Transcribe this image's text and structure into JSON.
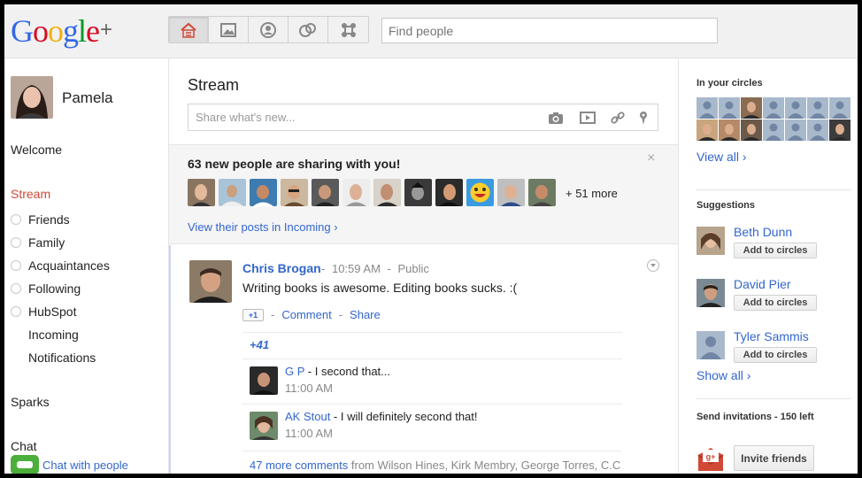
{
  "brand": {
    "letters": [
      {
        "ch": "G",
        "color": "#3369e8"
      },
      {
        "ch": "o",
        "color": "#d50f25"
      },
      {
        "ch": "o",
        "color": "#eeb211"
      },
      {
        "ch": "g",
        "color": "#3369e8"
      },
      {
        "ch": "l",
        "color": "#009925"
      },
      {
        "ch": "e",
        "color": "#d50f25"
      }
    ],
    "plus": "+"
  },
  "nav": {
    "buttons": [
      {
        "name": "home",
        "icon": "home-stream-icon",
        "active": true
      },
      {
        "name": "photos",
        "icon": "photos-icon",
        "active": false
      },
      {
        "name": "profile",
        "icon": "profile-icon",
        "active": false
      },
      {
        "name": "circles",
        "icon": "circles-icon",
        "active": false
      },
      {
        "name": "games",
        "icon": "games-icon",
        "active": false
      }
    ],
    "search_placeholder": "Find people"
  },
  "left": {
    "user_name": "Pamela",
    "welcome": "Welcome",
    "stream": "Stream",
    "circles": [
      "Friends",
      "Family",
      "Acquaintances",
      "Following",
      "HubSpot"
    ],
    "incoming": "Incoming",
    "notifications": "Notifications",
    "sparks": "Sparks",
    "chat": "Chat",
    "chat_link": "Chat with people"
  },
  "main": {
    "title": "Stream",
    "share_placeholder": "Share what's new...",
    "new_people": {
      "title": "63 new people are sharing with you!",
      "close": "×",
      "more": "+ 51 more",
      "link": "View their posts in Incoming ›"
    },
    "post": {
      "author": "Chris Brogan",
      "time": "10:59 AM",
      "visibility": "Public",
      "text": "Writing books is awesome. Editing books sucks. :(",
      "plusone_label": "+1",
      "comment_label": "Comment",
      "share_label": "Share",
      "separator": "-",
      "plus_count": "+41",
      "comments": [
        {
          "name": "G P",
          "text": " - I second that...",
          "time": "11:00 AM"
        },
        {
          "name": "AK Stout",
          "text": " - I will definitely second that!",
          "time": "11:00 AM"
        }
      ],
      "more_comments_link": "47 more comments",
      "more_comments_from": " from Wilson Hines, Kirk Membry, George Torres, C.C"
    }
  },
  "right": {
    "in_your_circles": "In your circles",
    "view_all": "View all ›",
    "suggestions_title": "Suggestions",
    "suggestions": [
      {
        "name": "Beth Dunn",
        "button": "Add to circles"
      },
      {
        "name": "David Pier",
        "button": "Add to circles"
      },
      {
        "name": "Tyler Sammis",
        "button": "Add to circles"
      }
    ],
    "show_all": "Show all ›",
    "invitations": "Send invitations - 150 left",
    "invite_button": "Invite friends"
  },
  "colors": {
    "link": "#3366cc",
    "accent_red": "#d14836"
  }
}
